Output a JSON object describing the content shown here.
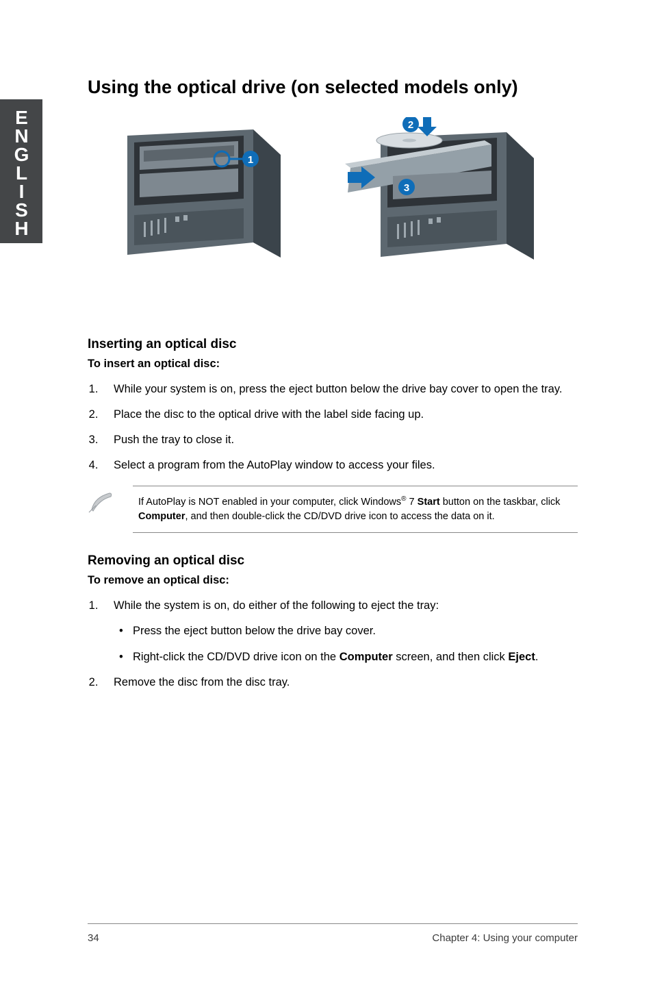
{
  "lang_tab": "ENGLISH",
  "title": "Using the optical drive (on selected models only)",
  "figure_markers": {
    "one": "1",
    "two": "2",
    "three": "3"
  },
  "insert": {
    "heading": "Inserting an optical disc",
    "sub": "To insert an optical disc:",
    "steps": [
      "While your system is on, press the eject button below the drive bay cover to open the tray.",
      "Place the disc to the optical drive with the label side facing up.",
      "Push the tray to close it.",
      "Select a program from the AutoPlay window to access your files."
    ]
  },
  "note": {
    "pre": "If AutoPlay is NOT enabled in your computer, click Windows",
    "reg": "®",
    "mid": " 7 ",
    "start": "Start",
    "after_start": " button on the taskbar, click ",
    "computer": "Computer",
    "tail": ", and then double-click the CD/DVD drive icon to access the data on it."
  },
  "remove": {
    "heading": "Removing an optical disc",
    "sub": "To remove an optical disc:",
    "step1": "While the system is on, do either of the following to eject the tray:",
    "bullets": {
      "b1": "Press the eject button below the drive bay cover.",
      "b2_pre": "Right-click the CD/DVD drive icon on the ",
      "b2_comp": "Computer",
      "b2_mid": " screen, and then click ",
      "b2_eject": "Eject",
      "b2_end": "."
    },
    "step2": "Remove the disc from the disc tray."
  },
  "footer": {
    "page": "34",
    "chapter": "Chapter 4: Using your computer"
  }
}
